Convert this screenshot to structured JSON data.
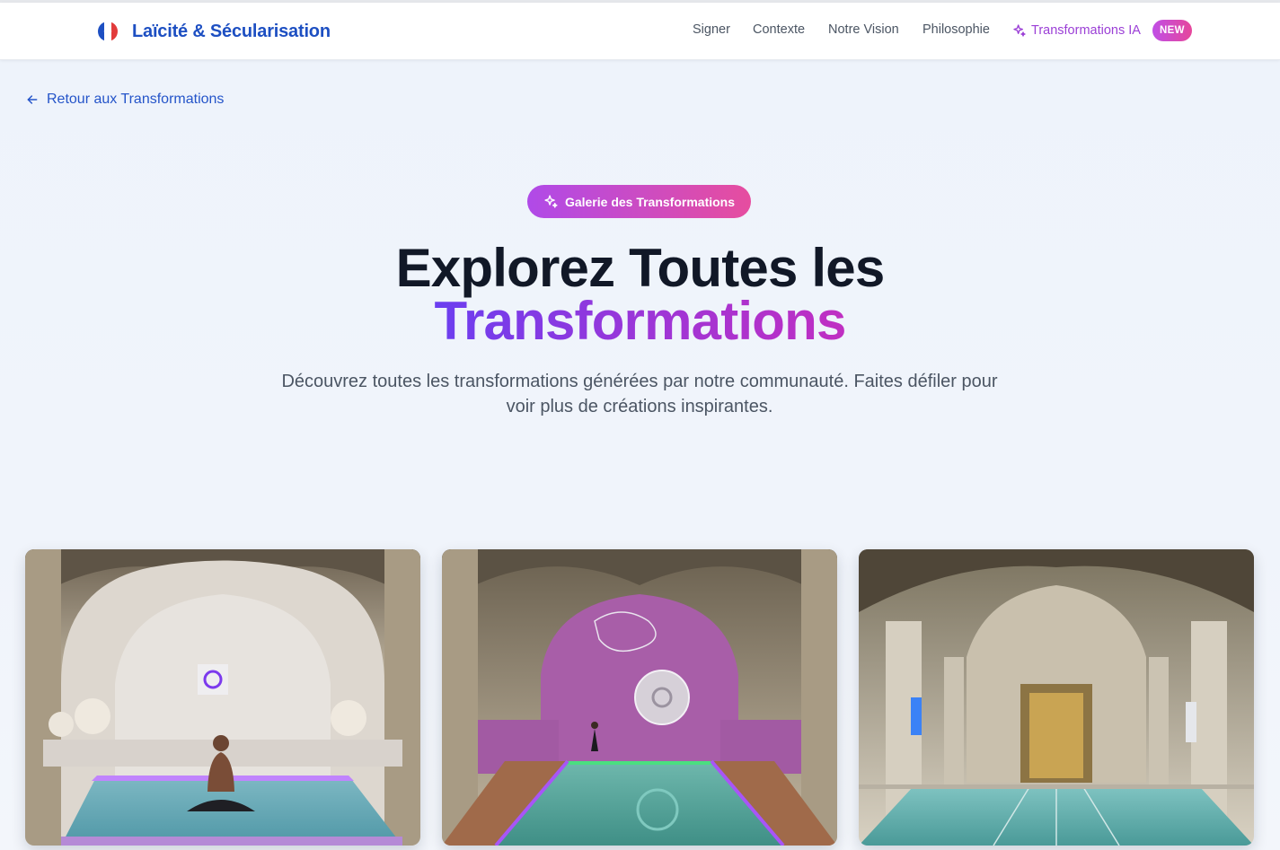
{
  "brand": {
    "title": "Laïcité & Sécularisation",
    "logo_icon": "french-flag-circle-icon",
    "colors": [
      "#1d4fc2",
      "#ffffff",
      "#e23b3b"
    ]
  },
  "nav": {
    "items": [
      "Signer",
      "Contexte",
      "Notre Vision",
      "Philosophie"
    ],
    "highlight": {
      "label": "Transformations IA",
      "icon": "sparkles-icon",
      "badge": "NEW"
    }
  },
  "back_link": {
    "label": "Retour aux Transformations",
    "icon": "arrow-left-icon"
  },
  "hero": {
    "badge": {
      "label": "Galerie des Transformations",
      "icon": "sparkles-icon"
    },
    "title_line1": "Explorez Toutes les",
    "title_line2": "Transformations",
    "subtitle": "Découvrez toutes les transformations générées par notre communauté. Faites défiler pour voir plus de créations inspirantes."
  },
  "gallery": [
    {
      "name": "meditation-pool-vaulted-hall"
    },
    {
      "name": "violet-chamber-pool-with-suspended-sculpture"
    },
    {
      "name": "cathedral-nave-indoor-swimming-pool"
    }
  ],
  "colors": {
    "accent_blue": "#1d4fc2",
    "accent_purple": "#9b3fd6",
    "accent_pink": "#e6479b"
  }
}
